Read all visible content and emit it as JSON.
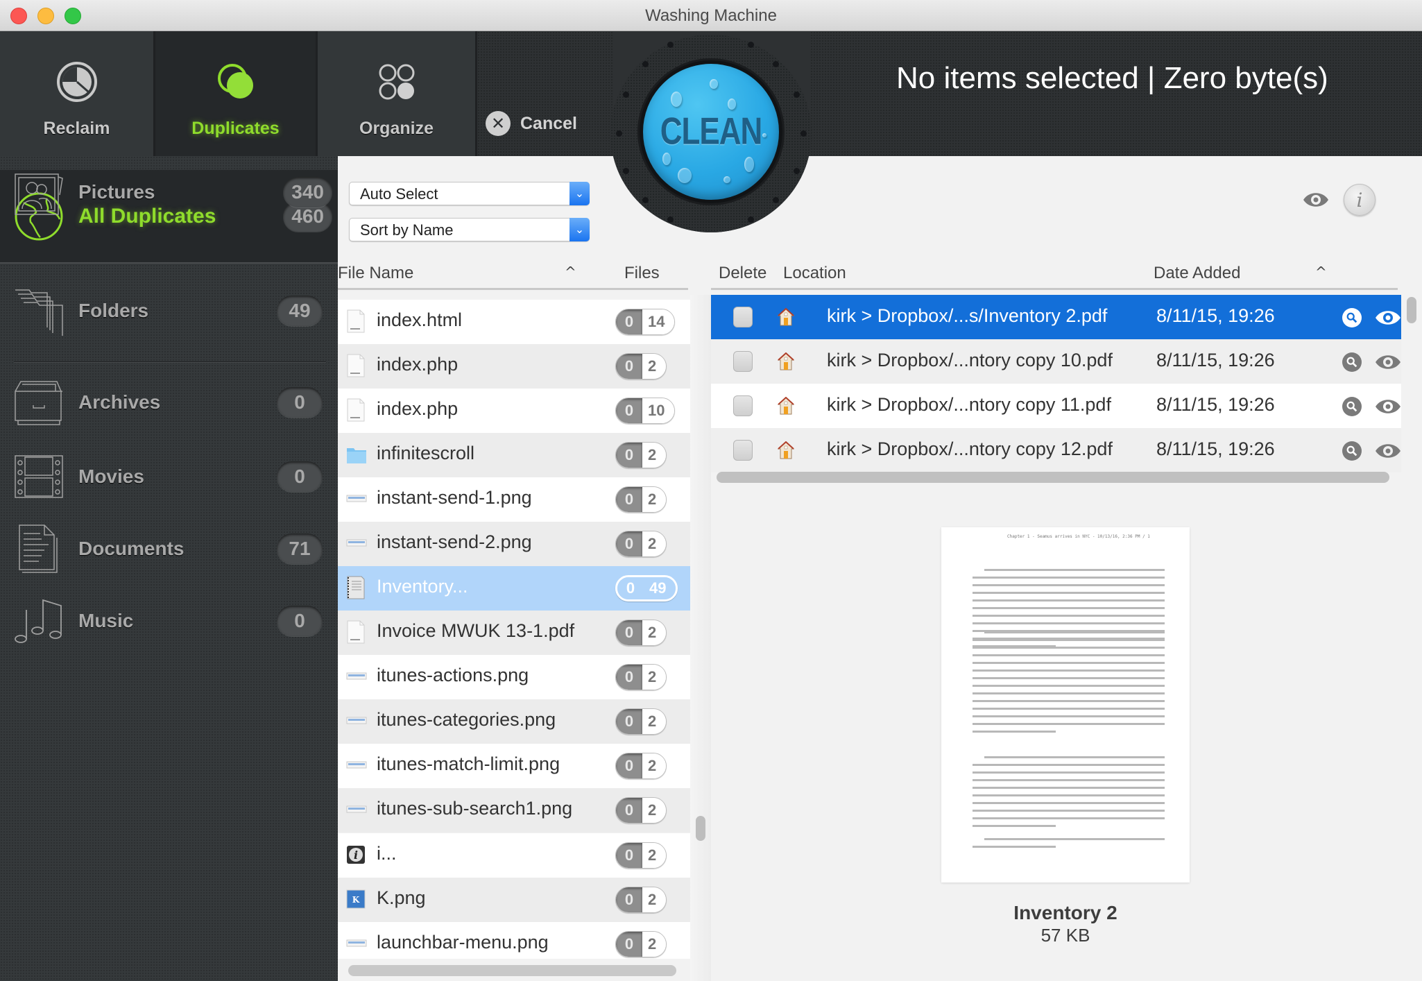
{
  "window": {
    "title": "Washing Machine"
  },
  "toolbar": {
    "tabs": [
      {
        "label": "Reclaim",
        "icon": "clock-icon",
        "active": false
      },
      {
        "label": "Duplicates",
        "icon": "overlapping-circles-icon",
        "active": true
      },
      {
        "label": "Organize",
        "icon": "grid-circles-icon",
        "active": false
      }
    ],
    "cancel_label": "Cancel",
    "clean_label": "CLEAN",
    "status": "No items selected | Zero byte(s)"
  },
  "sidebar": {
    "items": [
      {
        "label": "All Duplicates",
        "count": "460",
        "icon": "globe-icon",
        "active": true
      },
      {
        "label": "Folders",
        "count": "49",
        "icon": "folders-icon"
      },
      {
        "label": "Archives",
        "count": "0",
        "icon": "archive-drawer-icon"
      },
      {
        "label": "Movies",
        "count": "0",
        "icon": "film-strip-icon"
      },
      {
        "label": "Documents",
        "count": "71",
        "icon": "document-icon"
      },
      {
        "label": "Music",
        "count": "0",
        "icon": "music-notes-icon"
      },
      {
        "label": "Pictures",
        "count": "340",
        "icon": "picture-people-icon"
      }
    ]
  },
  "controls": {
    "auto_select": "Auto Select",
    "sort": "Sort by Name"
  },
  "file_list": {
    "headers": {
      "name": "File Name",
      "files": "Files"
    },
    "rows": [
      {
        "name": "index.html",
        "delete": "0",
        "files": "14",
        "icon": "html-file-icon"
      },
      {
        "name": "index.php",
        "delete": "0",
        "files": "2",
        "icon": "php-file-icon"
      },
      {
        "name": "index.php",
        "delete": "0",
        "files": "10",
        "icon": "php-file-icon"
      },
      {
        "name": "infinitescroll",
        "delete": "0",
        "files": "2",
        "icon": "folder-icon"
      },
      {
        "name": "instant-send-1.png",
        "delete": "0",
        "files": "2",
        "icon": "image-file-icon"
      },
      {
        "name": "instant-send-2.png",
        "delete": "0",
        "files": "2",
        "icon": "image-file-icon"
      },
      {
        "name": "Inventory...",
        "delete": "0",
        "files": "49",
        "icon": "pdf-file-icon",
        "selected": true
      },
      {
        "name": "Invoice MWUK 13-1.pdf",
        "delete": "0",
        "files": "2",
        "icon": "pdf-file-icon"
      },
      {
        "name": "itunes-actions.png",
        "delete": "0",
        "files": "2",
        "icon": "image-file-icon"
      },
      {
        "name": "itunes-categories.png",
        "delete": "0",
        "files": "2",
        "icon": "image-file-icon"
      },
      {
        "name": "itunes-match-limit.png",
        "delete": "0",
        "files": "2",
        "icon": "image-file-icon"
      },
      {
        "name": "itunes-sub-search1.png",
        "delete": "0",
        "files": "2",
        "icon": "image-file-icon"
      },
      {
        "name": "i...",
        "delete": "0",
        "files": "2",
        "icon": "info-app-icon"
      },
      {
        "name": "K.png",
        "delete": "0",
        "files": "2",
        "icon": "k-image-icon"
      },
      {
        "name": "launchbar-menu.png",
        "delete": "0",
        "files": "2",
        "icon": "image-file-icon"
      }
    ]
  },
  "location_table": {
    "headers": {
      "delete": "Delete",
      "location": "Location",
      "date": "Date Added"
    },
    "rows": [
      {
        "location": "kirk > Dropbox/...s/Inventory 2.pdf",
        "date": "8/11/15, 19:26",
        "selected": true
      },
      {
        "location": "kirk > Dropbox/...ntory copy 10.pdf",
        "date": "8/11/15, 19:26"
      },
      {
        "location": "kirk > Dropbox/...ntory copy 11.pdf",
        "date": "8/11/15, 19:26"
      },
      {
        "location": "kirk > Dropbox/...ntory copy 12.pdf",
        "date": "8/11/15, 19:26"
      }
    ]
  },
  "preview": {
    "header": "Chapter 1 - Seamus arrives in NYC - 10/13/16, 2:36 PM / 1",
    "name": "Inventory 2",
    "size": "57 KB"
  },
  "colors": {
    "accent_green": "#8fdc2c",
    "selection_blue": "#136fd9",
    "selection_light_blue": "#b1d5fa",
    "clean_blue": "#29a8e4"
  }
}
